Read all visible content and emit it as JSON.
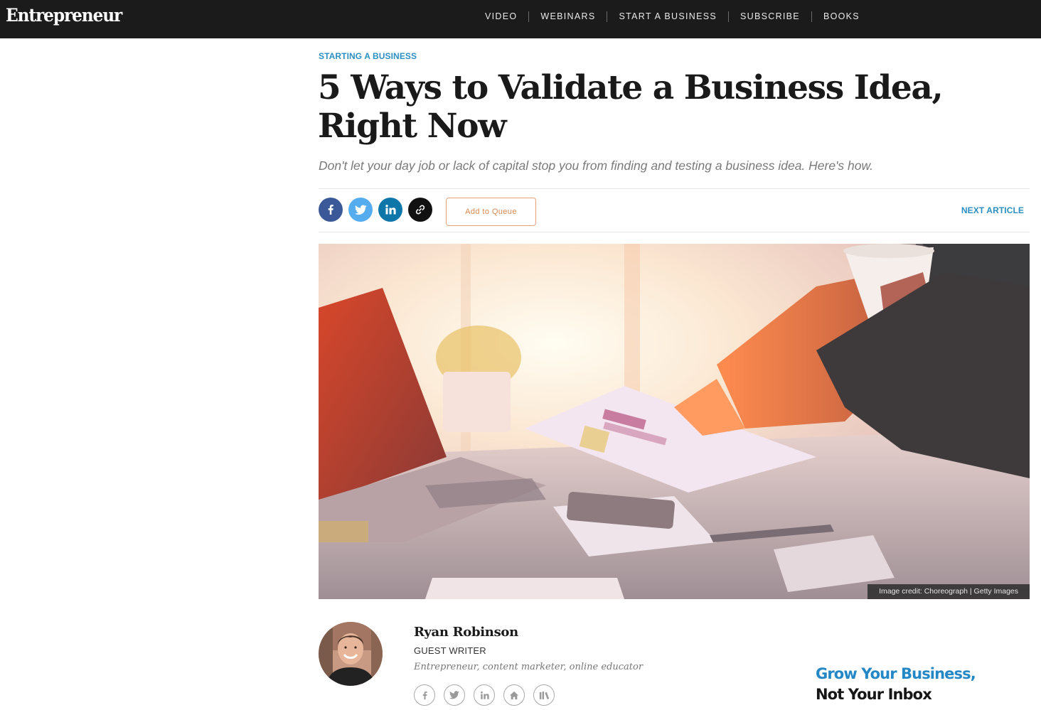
{
  "header": {
    "logo": "Entrepreneur",
    "nav": [
      "VIDEO",
      "WEBINARS",
      "START A BUSINESS",
      "SUBSCRIBE",
      "BOOKS"
    ]
  },
  "article": {
    "category": "STARTING A BUSINESS",
    "title": "5 Ways to Validate a Business Idea, Right Now",
    "dek": "Don't let your day job or lack of capital stop you from finding and testing a business idea. Here's how.",
    "add_to_queue": "Add to Queue",
    "next_article": "NEXT ARTICLE",
    "image_credit": "Image credit: Choreograph | Getty Images"
  },
  "share_icons": [
    "facebook-icon",
    "twitter-icon",
    "linkedin-icon",
    "link-icon"
  ],
  "author": {
    "name": "Ryan Robinson",
    "role": "GUEST WRITER",
    "bio": "Entrepreneur, content marketer, online educator",
    "social_icons": [
      "facebook-icon",
      "twitter-icon",
      "linkedin-icon",
      "home-icon",
      "books-icon"
    ]
  },
  "promo": {
    "line1": "Grow Your Business,",
    "line2": "Not Your Inbox"
  },
  "colors": {
    "topbar": "#1b1b1b",
    "accent_blue": "#2c8fc0",
    "facebook": "#3b5998",
    "twitter": "#55acee",
    "linkedin": "#0e76a8",
    "queue_orange": "#d9874f"
  }
}
